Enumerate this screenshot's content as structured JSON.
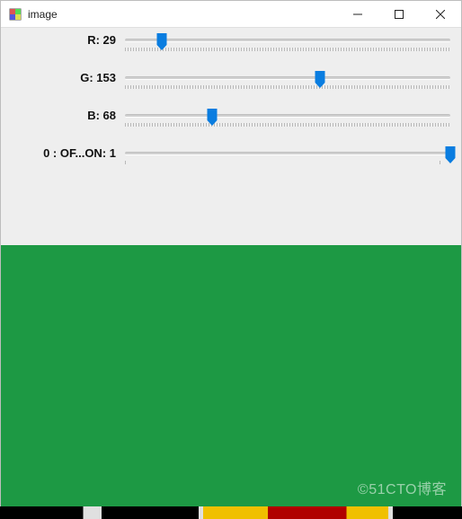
{
  "window": {
    "title": "image"
  },
  "trackbars": {
    "r": {
      "label": "R: 29",
      "value": 29,
      "min": 0,
      "max": 255
    },
    "g": {
      "label": "G: 153",
      "value": 153,
      "min": 0,
      "max": 255
    },
    "b": {
      "label": "B: 68",
      "value": 68,
      "min": 0,
      "max": 255
    },
    "switch": {
      "label": "0 : OF...ON: 1",
      "value": 1,
      "min": 0,
      "max": 1
    }
  },
  "color": {
    "r": 29,
    "g": 153,
    "b": 68
  },
  "watermark": "©51CTO博客"
}
